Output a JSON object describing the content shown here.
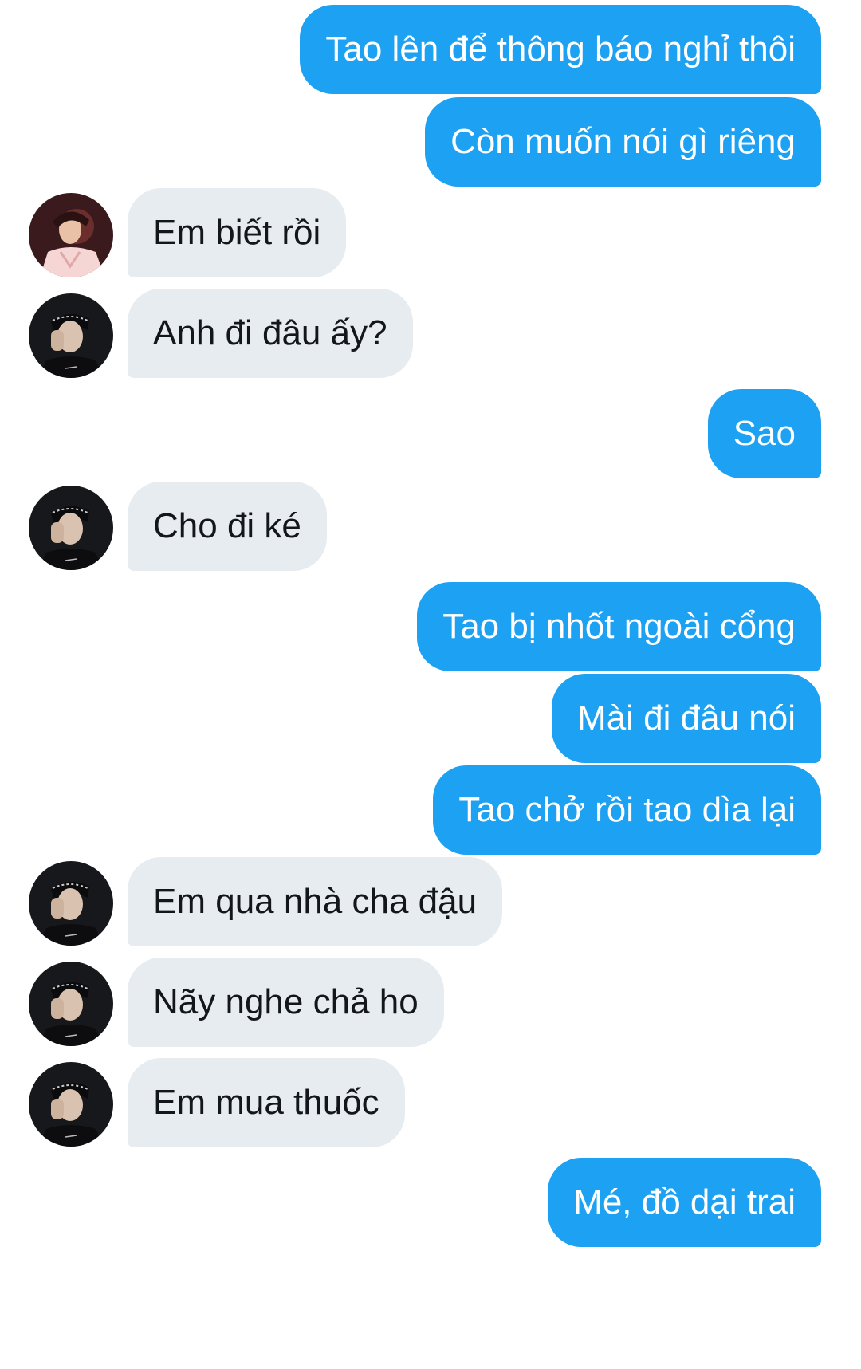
{
  "messages": [
    {
      "side": "out",
      "text": "Tao lên để thông báo nghỉ thôi"
    },
    {
      "side": "out",
      "text": "Còn muốn nói gì riêng"
    },
    {
      "side": "in",
      "avatar": "avatar-pink-jacket",
      "text": "Em biết rồi"
    },
    {
      "side": "in",
      "avatar": "avatar-dark-hand-face",
      "text": "Anh đi đâu ấy?"
    },
    {
      "side": "out",
      "text": "Sao"
    },
    {
      "side": "in",
      "avatar": "avatar-dark-hand-face",
      "text": "Cho đi ké"
    },
    {
      "side": "out",
      "text": "Tao bị nhốt ngoài cổng"
    },
    {
      "side": "out",
      "text": "Mài đi đâu nói"
    },
    {
      "side": "out",
      "text": "Tao chở rồi tao dìa lại"
    },
    {
      "side": "in",
      "avatar": "avatar-dark-hand-face",
      "text": "Em qua nhà cha đậu"
    },
    {
      "side": "in",
      "avatar": "avatar-dark-hand-face",
      "text": "Nãy nghe chả ho"
    },
    {
      "side": "in",
      "avatar": "avatar-dark-hand-face",
      "text": "Em mua thuốc"
    },
    {
      "side": "out",
      "text": "Mé, đồ dại trai"
    }
  ],
  "colors": {
    "outgoing_bubble": "#1da1f2",
    "incoming_bubble": "#e6ecf0",
    "incoming_text": "#14171a",
    "outgoing_text": "#ffffff"
  }
}
